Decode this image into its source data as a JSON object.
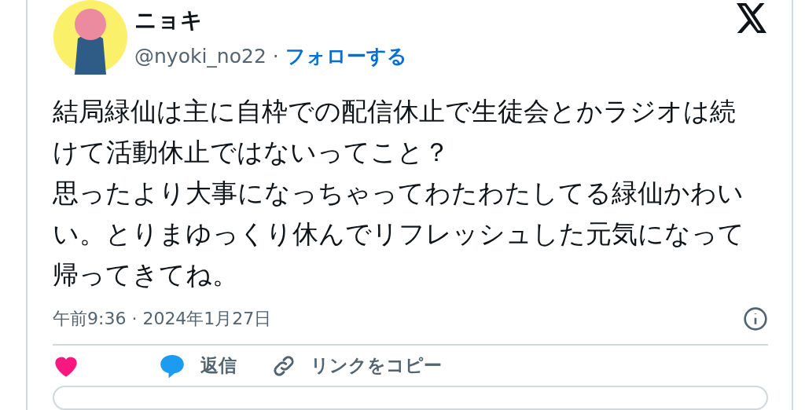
{
  "author": {
    "name": "ニョキ",
    "handle": "@nyoki_no22",
    "separator": "·",
    "follow": "フォローする"
  },
  "body": [
    "結局緑仙は主に自枠での配信休止で生徒会とかラジオは続けて活動休止ではないってこと？",
    "思ったより大事になっちゃってわたわたしてる緑仙かわいい。とりまゆっくり休んでリフレッシュした元気になって帰ってきてね。"
  ],
  "timestamp": "午前9:36 · 2024年1月27日",
  "actions": [
    {
      "kind": "like"
    },
    {
      "kind": "reply",
      "label": "返信"
    },
    {
      "kind": "link",
      "label": "リンクをコピー"
    }
  ]
}
